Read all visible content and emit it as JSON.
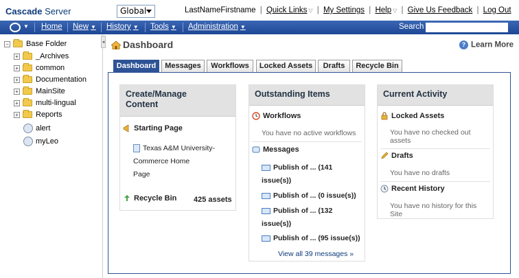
{
  "header": {
    "logo": {
      "brand": "Cascade",
      "suffix": "Server"
    },
    "site_select": "Global",
    "user_name": "LastNameFirstname",
    "quick_links": "Quick Links",
    "my_settings": "My Settings",
    "help": "Help",
    "feedback": "Give Us Feedback",
    "logout": "Log Out"
  },
  "menubar": {
    "items": [
      {
        "label": "Home"
      },
      {
        "label": "New"
      },
      {
        "label": "History"
      },
      {
        "label": "Tools"
      },
      {
        "label": "Administration"
      }
    ],
    "search_label": "Search",
    "search_value": ""
  },
  "sidebar": {
    "root": "Base Folder",
    "folders": [
      "_Archives",
      "common",
      "Documentation",
      "MainSite",
      "multi-lingual",
      "Reports"
    ],
    "feeds": [
      "alert",
      "myLeo"
    ]
  },
  "page": {
    "title": "Dashboard",
    "learn_more": "Learn More"
  },
  "tabs": [
    {
      "label": "Dashboard",
      "active": true
    },
    {
      "label": "Messages"
    },
    {
      "label": "Workflows"
    },
    {
      "label": "Locked Assets"
    },
    {
      "label": "Drafts"
    },
    {
      "label": "Recycle Bin"
    }
  ],
  "cards": {
    "create": {
      "title_line1": "Create/Manage",
      "title_line2": "Content",
      "starting_page_label": "Starting Page",
      "starting_page_link_l1": "Texas A&M University-",
      "starting_page_link_l2": "Commerce Home",
      "starting_page_link_l3": "Page",
      "recycle_label": "Recycle Bin",
      "recycle_count": "425 assets"
    },
    "outstanding": {
      "title": "Outstanding Items",
      "workflows_label": "Workflows",
      "workflows_empty": "You have no active workflows",
      "messages_label": "Messages",
      "messages": [
        {
          "l1": "Publish of ... (141",
          "l2": "issue(s))"
        },
        {
          "l1": "Publish of ... (0 issue(s))",
          "l2": ""
        },
        {
          "l1": "Publish of ... (132",
          "l2": "issue(s))"
        },
        {
          "l1": "Publish of ... (95 issue(s))",
          "l2": ""
        }
      ],
      "view_all": "View all 39 messages »"
    },
    "activity": {
      "title": "Current Activity",
      "locked_label": "Locked Assets",
      "locked_empty_l1": "You have no checked out",
      "locked_empty_l2": "assets",
      "drafts_label": "Drafts",
      "drafts_empty": "You have no drafts",
      "history_label": "Recent History",
      "history_empty_l1": "You have no history for this",
      "history_empty_l2": "Site"
    }
  },
  "colors": {
    "menubar": "#1e4795",
    "tab_active": "#2d5396",
    "link_blue": "#0b3a7a"
  }
}
